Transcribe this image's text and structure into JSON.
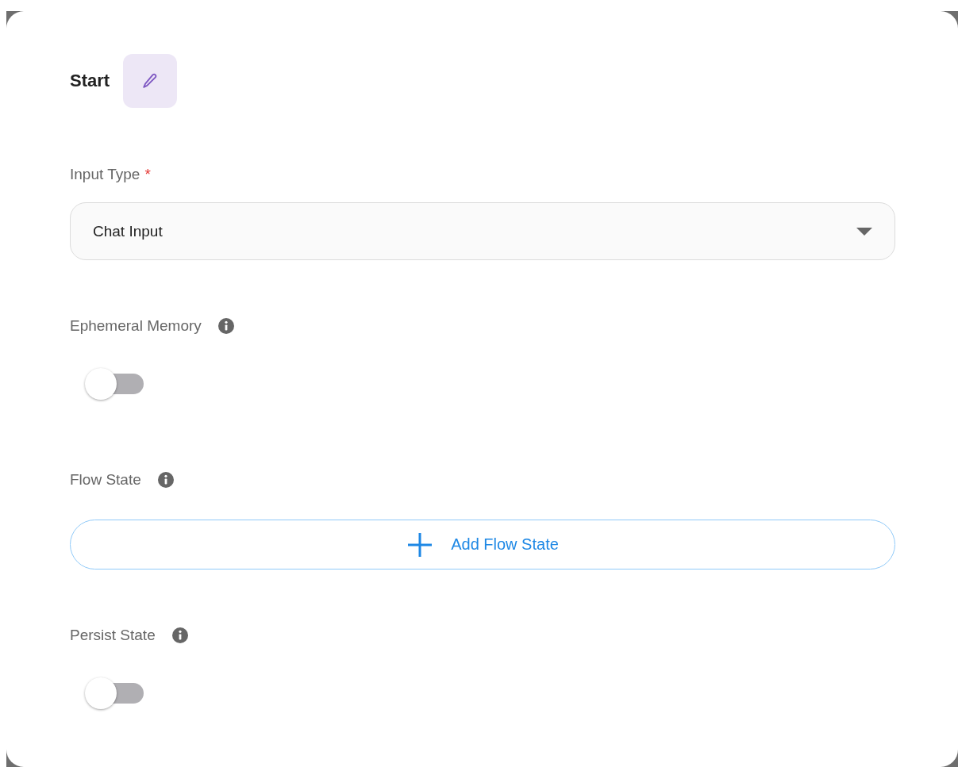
{
  "title": "Start",
  "fields": [
    {
      "kind": "select",
      "label": "Input Type",
      "required_mark": "*",
      "value": "Chat Input"
    },
    {
      "kind": "toggle",
      "label": "Ephemeral Memory",
      "info": true,
      "on": false
    },
    {
      "kind": "button",
      "label": "Flow State",
      "info": true,
      "button": "Add Flow State"
    },
    {
      "kind": "toggle",
      "label": "Persist State",
      "info": true,
      "on": false
    }
  ]
}
